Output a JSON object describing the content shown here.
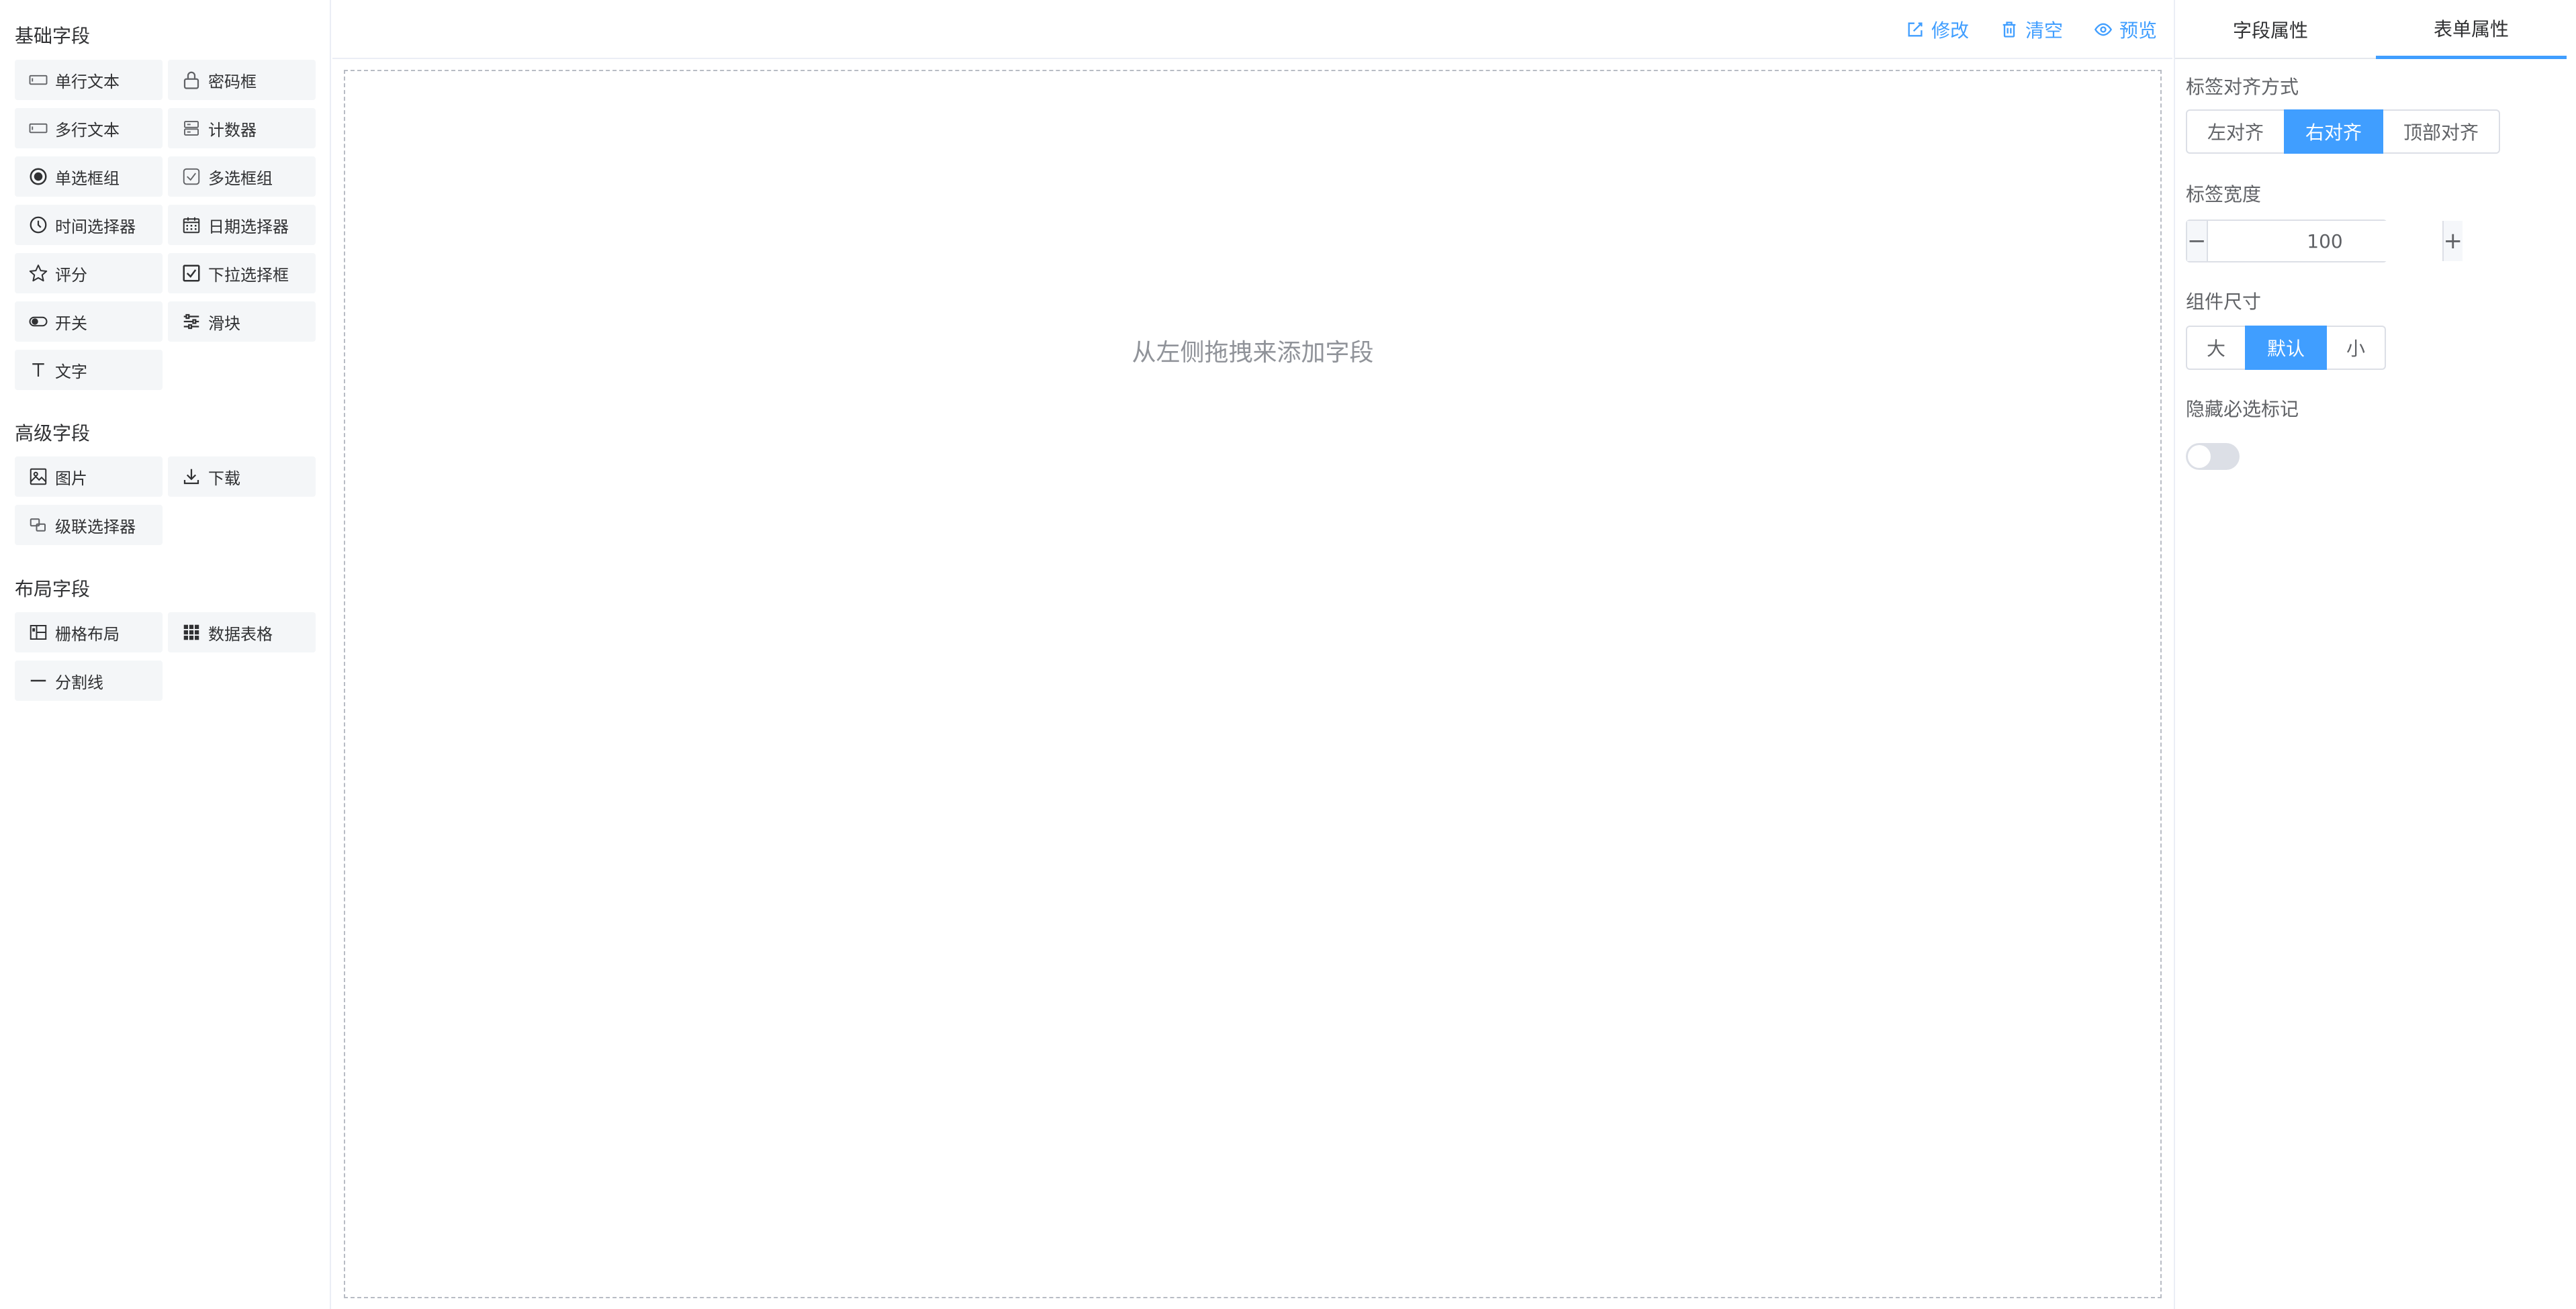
{
  "left": {
    "basic_title": "基础字段",
    "advanced_title": "高级字段",
    "layout_title": "布局字段",
    "basic": [
      {
        "label": "单行文本",
        "icon": "input-icon"
      },
      {
        "label": "密码框",
        "icon": "lock-icon"
      },
      {
        "label": "多行文本",
        "icon": "textarea-icon"
      },
      {
        "label": "计数器",
        "icon": "counter-icon"
      },
      {
        "label": "单选框组",
        "icon": "radio-icon"
      },
      {
        "label": "多选框组",
        "icon": "checkbox-icon"
      },
      {
        "label": "时间选择器",
        "icon": "clock-icon"
      },
      {
        "label": "日期选择器",
        "icon": "calendar-icon"
      },
      {
        "label": "评分",
        "icon": "star-icon"
      },
      {
        "label": "下拉选择框",
        "icon": "select-icon"
      },
      {
        "label": "开关",
        "icon": "switch-icon"
      },
      {
        "label": "滑块",
        "icon": "slider-icon"
      },
      {
        "label": "文字",
        "icon": "text-icon"
      }
    ],
    "advanced": [
      {
        "label": "图片",
        "icon": "image-icon"
      },
      {
        "label": "下载",
        "icon": "download-icon"
      },
      {
        "label": "级联选择器",
        "icon": "cascader-icon"
      }
    ],
    "layout": [
      {
        "label": "栅格布局",
        "icon": "grid-icon"
      },
      {
        "label": "数据表格",
        "icon": "table-icon"
      },
      {
        "label": "分割线",
        "icon": "divider-icon"
      }
    ]
  },
  "toolbar": {
    "edit": "修改",
    "clear": "清空",
    "preview": "预览"
  },
  "canvas": {
    "empty_tip": "从左侧拖拽来添加字段"
  },
  "right": {
    "tabs": [
      "字段属性",
      "表单属性"
    ],
    "active_tab": "表单属性",
    "label_align": {
      "label": "标签对齐方式",
      "options": [
        "左对齐",
        "右对齐",
        "顶部对齐"
      ],
      "selected": "右对齐"
    },
    "label_width": {
      "label": "标签宽度",
      "value": "100"
    },
    "size": {
      "label": "组件尺寸",
      "options": [
        "大",
        "默认",
        "小"
      ],
      "selected": "默认"
    },
    "hide_required": {
      "label": "隐藏必选标记",
      "value": false
    }
  },
  "colors": {
    "accent": "#409eff",
    "item_bg": "#f4f6f8",
    "border": "#dcdfe6",
    "muted_text": "#909399"
  }
}
